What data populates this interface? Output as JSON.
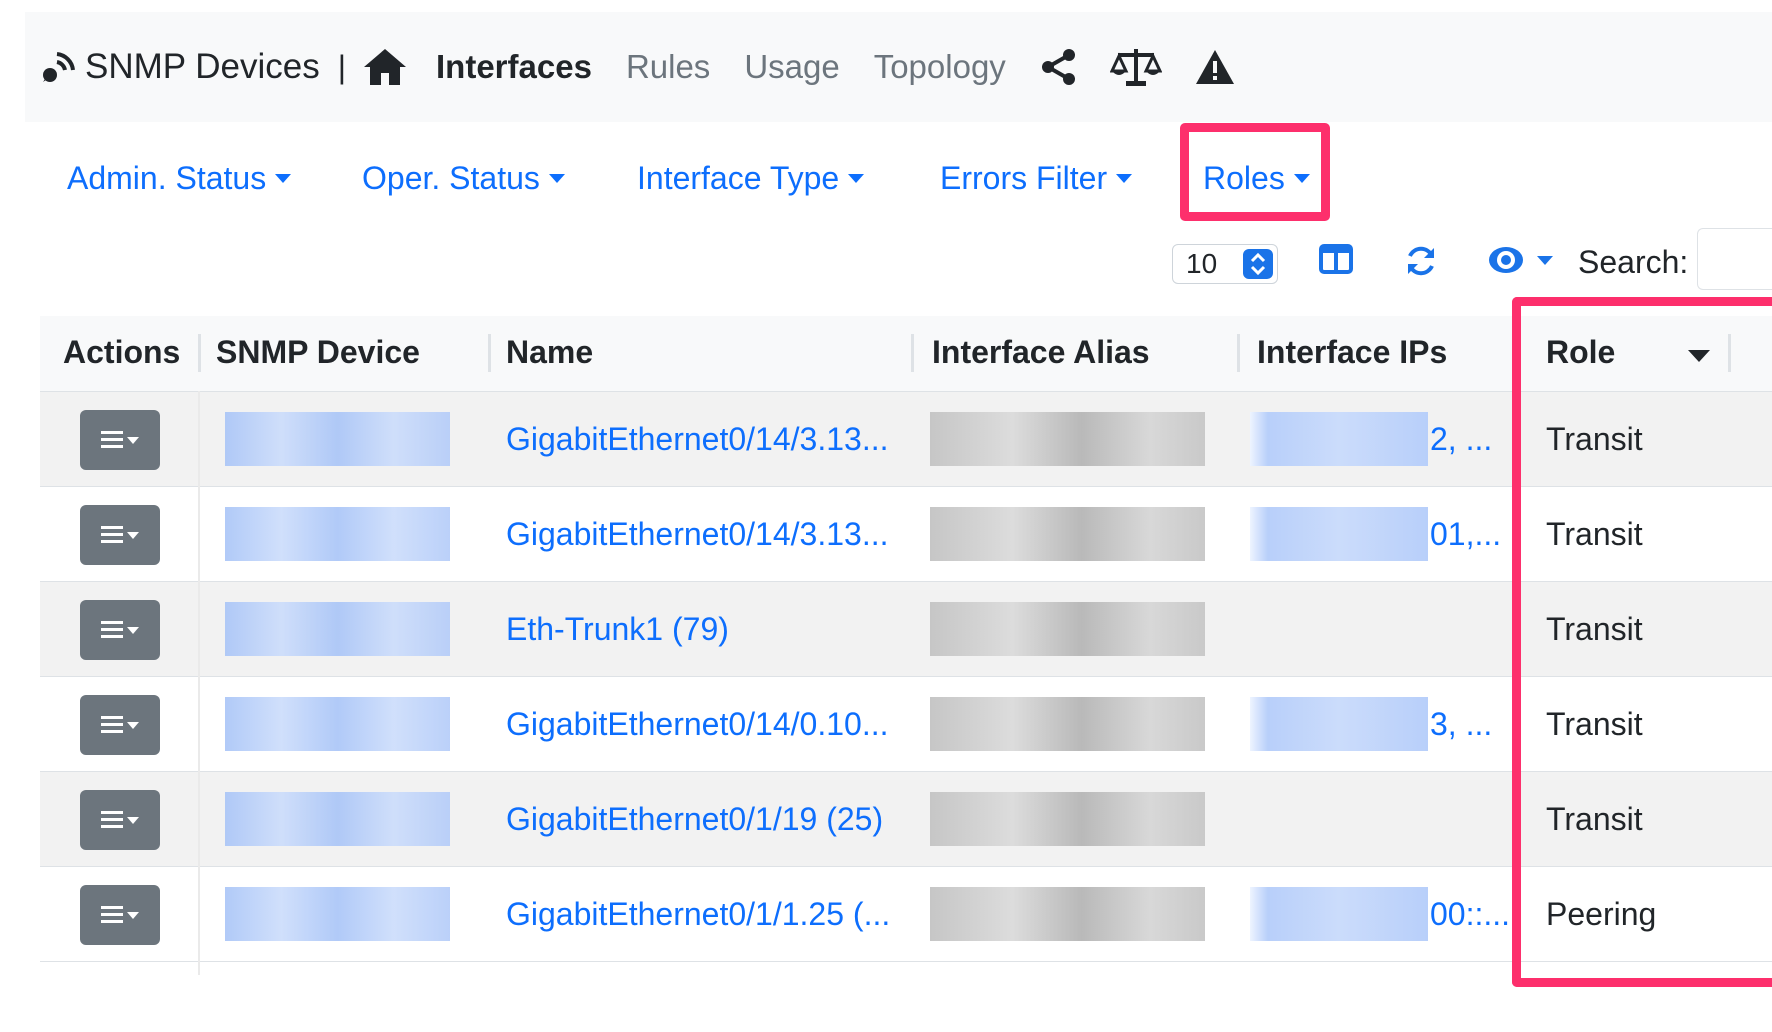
{
  "navbar": {
    "brand": "SNMP Devices",
    "separator": "|",
    "links": [
      "Interfaces",
      "Rules",
      "Usage",
      "Topology"
    ],
    "active": "Interfaces",
    "icons": [
      "home-icon",
      "share-icon",
      "scale-icon",
      "warning-icon"
    ]
  },
  "filters": [
    "Admin. Status",
    "Oper. Status",
    "Interface Type",
    "Errors Filter",
    "Roles"
  ],
  "toolbar": {
    "page_size": "10",
    "search_label": "Search:"
  },
  "table": {
    "columns": [
      "Actions",
      "SNMP Device",
      "Name",
      "Interface Alias",
      "Interface IPs",
      "Role"
    ],
    "rows": [
      {
        "name": "GigabitEthernet0/14/3.13...",
        "ip_tail": "2, ...",
        "role": "Transit"
      },
      {
        "name": "GigabitEthernet0/14/3.13...",
        "ip_tail": "01,...",
        "role": "Transit"
      },
      {
        "name": "Eth-Trunk1 (79)",
        "ip_tail": "",
        "role": "Transit"
      },
      {
        "name": "GigabitEthernet0/14/0.10...",
        "ip_tail": "3, ...",
        "role": "Transit"
      },
      {
        "name": "GigabitEthernet0/1/19 (25)",
        "ip_tail": "",
        "role": "Transit"
      },
      {
        "name": "GigabitEthernet0/1/1.25 (...",
        "ip_tail": "00::...",
        "role": "Peering"
      }
    ]
  },
  "colors": {
    "link": "#0d6efd",
    "highlight": "#fd2f6c",
    "action_button": "#6c757d"
  }
}
